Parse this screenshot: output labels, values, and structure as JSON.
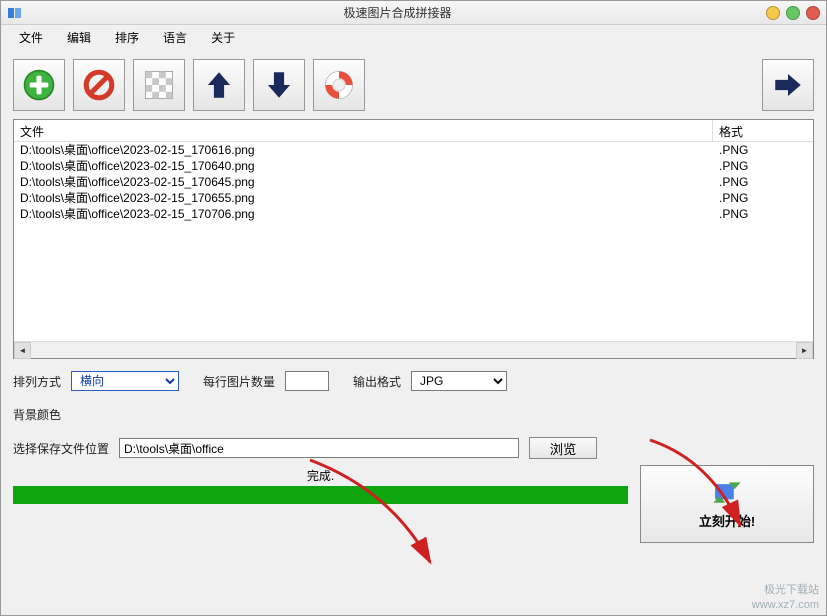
{
  "window": {
    "title": "极速图片合成拼接器"
  },
  "menu": {
    "file": "文件",
    "edit": "编辑",
    "sort": "排序",
    "language": "语言",
    "about": "关于"
  },
  "toolbar": {
    "add": "add-button",
    "remove": "remove-button",
    "clear": "clear-button",
    "move_up": "move-up-button",
    "move_down": "move-down-button",
    "help": "help-button",
    "next": "next-button"
  },
  "table": {
    "col_file": "文件",
    "col_format": "格式",
    "rows": [
      {
        "path": "D:\\tools\\桌面\\office\\2023-02-15_170616.png",
        "format": ".PNG"
      },
      {
        "path": "D:\\tools\\桌面\\office\\2023-02-15_170640.png",
        "format": ".PNG"
      },
      {
        "path": "D:\\tools\\桌面\\office\\2023-02-15_170645.png",
        "format": ".PNG"
      },
      {
        "path": "D:\\tools\\桌面\\office\\2023-02-15_170655.png",
        "format": ".PNG"
      },
      {
        "path": "D:\\tools\\桌面\\office\\2023-02-15_170706.png",
        "format": ".PNG"
      }
    ]
  },
  "options": {
    "arrange_label": "排列方式",
    "arrange_value": "横向",
    "per_row_label": "每行图片数量",
    "per_row_value": "",
    "out_format_label": "输出格式",
    "out_format_value": "JPG",
    "bg_color_label": "背景颜色",
    "save_path_label": "选择保存文件位置",
    "save_path_value": "D:\\tools\\桌面\\office",
    "browse_label": "浏览"
  },
  "progress": {
    "status_text": "完成.",
    "percent": 100
  },
  "start": {
    "label": "立刻开始!"
  },
  "watermark": {
    "line1": "极光下载站",
    "line2": "www.xz7.com"
  },
  "colors": {
    "progress_green": "#0fa50f",
    "add_green": "#3fb23f",
    "remove_red": "#d43a2a",
    "arrow_blue": "#1a2a5a",
    "next_blue": "#1a2a5a"
  }
}
